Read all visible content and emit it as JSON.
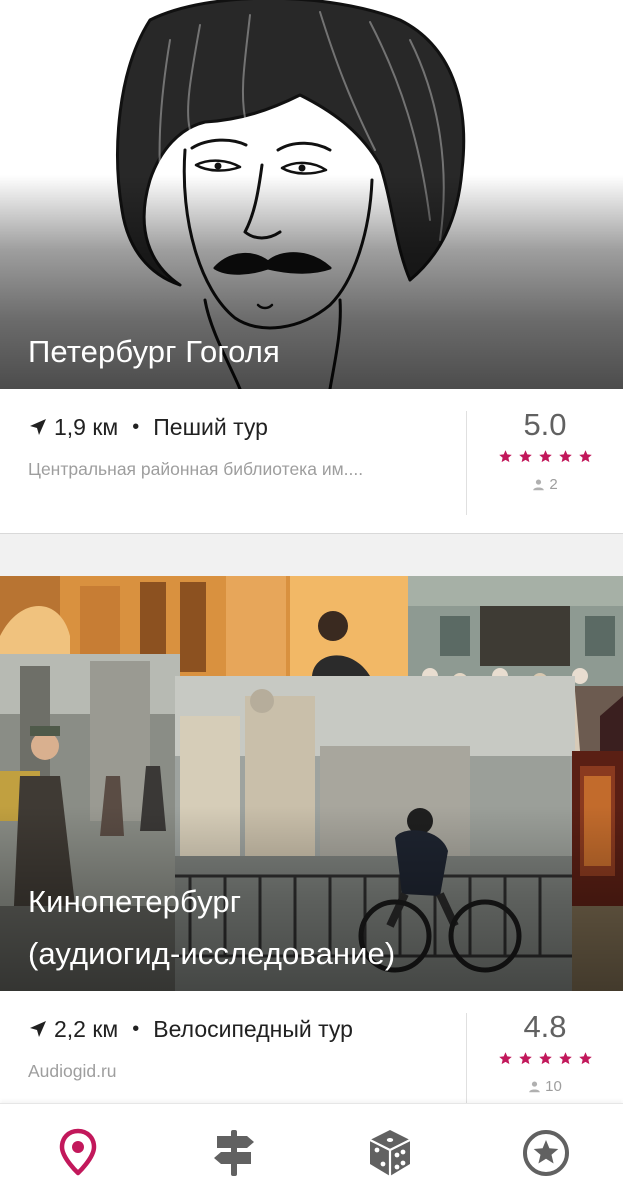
{
  "tours": [
    {
      "title": "Петербург Гоголя",
      "distance": "1,9 км",
      "separator": "•",
      "tour_type": "Пеший тур",
      "subtitle": "Центральная районная библиотека им....",
      "rating": "5.0",
      "stars": 5,
      "reviews_count": "2"
    },
    {
      "title_line1": "Кинопетербург",
      "title_line2": "(аудиогид-исследование)",
      "distance": "2,2 км",
      "separator": "•",
      "tour_type": "Велосипедный тур",
      "subtitle": "Audiogid.ru",
      "rating": "4.8",
      "stars": 5,
      "reviews_count": "10"
    }
  ],
  "bottom_nav": [
    {
      "name": "map-pin-icon",
      "active": true
    },
    {
      "name": "signpost-icon",
      "active": false
    },
    {
      "name": "dice-icon",
      "active": false
    },
    {
      "name": "star-circle-icon",
      "active": false
    }
  ],
  "colors": {
    "accent": "#c2185b",
    "nav_inactive": "#616161",
    "secondary_text": "#9e9e9e",
    "rating_text": "#616161"
  }
}
